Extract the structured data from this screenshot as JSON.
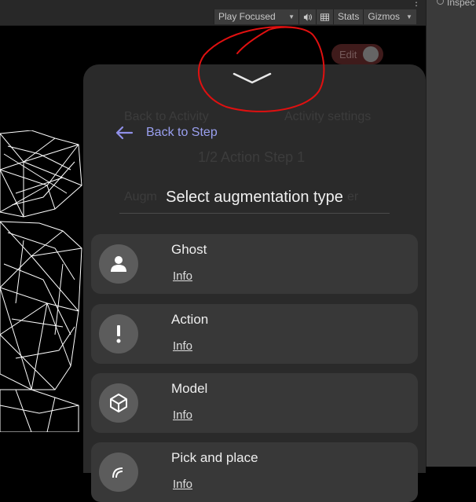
{
  "toolbar": {
    "play_mode": "Play Focused",
    "stats": "Stats",
    "gizmos": "Gizmos"
  },
  "inspector": {
    "label": "Inspec"
  },
  "background": {
    "back_to_activity": "Back to Activity",
    "activity_settings": "Activity settings",
    "step_title": "1/2 Action Step 1",
    "augm_left": "Augm",
    "augm_right": "er"
  },
  "edit_toggle": {
    "label": "Edit",
    "on": false
  },
  "dialog": {
    "back_label": "Back to Step",
    "title": "Select augmentation type",
    "items": [
      {
        "name": "Ghost",
        "info": "Info",
        "icon": "person-icon"
      },
      {
        "name": "Action",
        "info": "Info",
        "icon": "exclamation-icon"
      },
      {
        "name": "Model",
        "info": "Info",
        "icon": "cube-icon"
      },
      {
        "name": "Pick and place",
        "info": "Info",
        "icon": "pick-place-icon"
      }
    ]
  },
  "colors": {
    "accent": "#9aa0f0",
    "annotation": "#e01010",
    "panel": "#2a2a2a",
    "card": "#383838"
  }
}
